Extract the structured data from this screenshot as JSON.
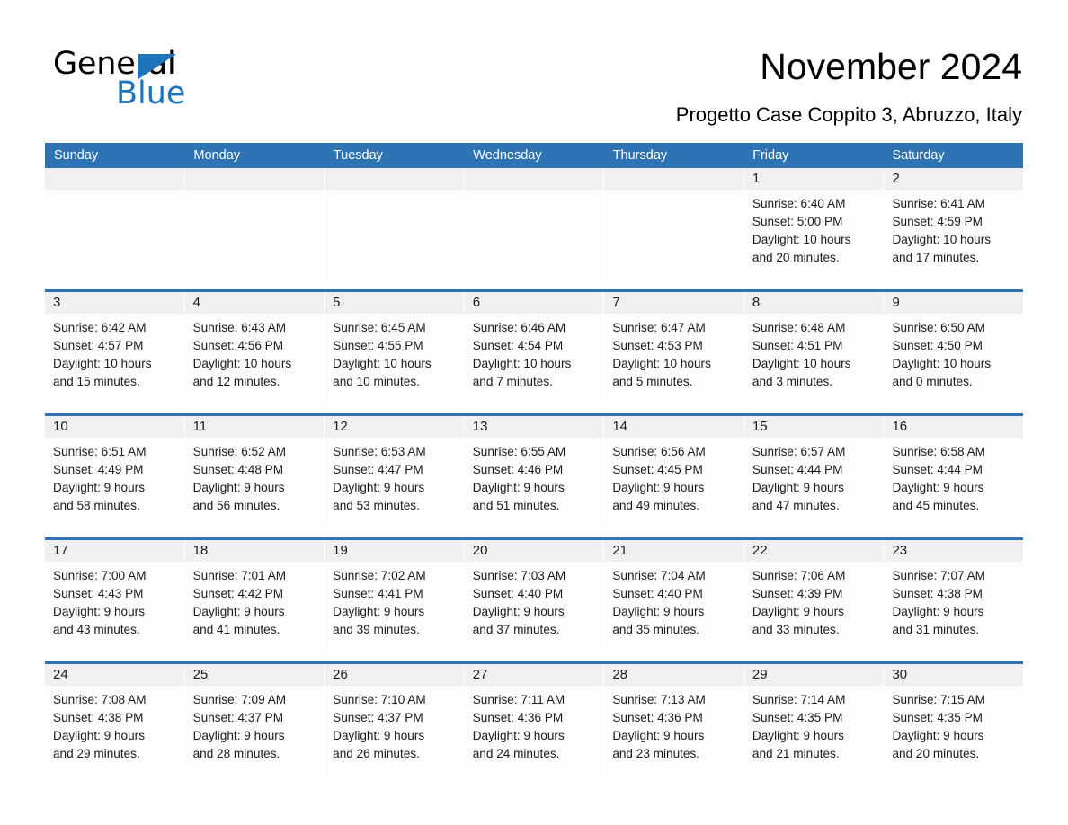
{
  "brand": {
    "name_part1": "General",
    "name_part2": "Blue",
    "accent_color": "#1f73b8"
  },
  "header": {
    "title": "November 2024",
    "subtitle": "Progetto Case Coppito 3, Abruzzo, Italy"
  },
  "theme": {
    "header_blue": "#2e74b5",
    "daynum_band": "#f0f0f0",
    "cell_bg": "#fdfdfd"
  },
  "weekdays": [
    "Sunday",
    "Monday",
    "Tuesday",
    "Wednesday",
    "Thursday",
    "Friday",
    "Saturday"
  ],
  "weeks": [
    [
      {
        "day": "",
        "lines": []
      },
      {
        "day": "",
        "lines": []
      },
      {
        "day": "",
        "lines": []
      },
      {
        "day": "",
        "lines": []
      },
      {
        "day": "",
        "lines": []
      },
      {
        "day": "1",
        "lines": [
          "Sunrise: 6:40 AM",
          "Sunset: 5:00 PM",
          "Daylight: 10 hours",
          "and 20 minutes."
        ]
      },
      {
        "day": "2",
        "lines": [
          "Sunrise: 6:41 AM",
          "Sunset: 4:59 PM",
          "Daylight: 10 hours",
          "and 17 minutes."
        ]
      }
    ],
    [
      {
        "day": "3",
        "lines": [
          "Sunrise: 6:42 AM",
          "Sunset: 4:57 PM",
          "Daylight: 10 hours",
          "and 15 minutes."
        ]
      },
      {
        "day": "4",
        "lines": [
          "Sunrise: 6:43 AM",
          "Sunset: 4:56 PM",
          "Daylight: 10 hours",
          "and 12 minutes."
        ]
      },
      {
        "day": "5",
        "lines": [
          "Sunrise: 6:45 AM",
          "Sunset: 4:55 PM",
          "Daylight: 10 hours",
          "and 10 minutes."
        ]
      },
      {
        "day": "6",
        "lines": [
          "Sunrise: 6:46 AM",
          "Sunset: 4:54 PM",
          "Daylight: 10 hours",
          "and 7 minutes."
        ]
      },
      {
        "day": "7",
        "lines": [
          "Sunrise: 6:47 AM",
          "Sunset: 4:53 PM",
          "Daylight: 10 hours",
          "and 5 minutes."
        ]
      },
      {
        "day": "8",
        "lines": [
          "Sunrise: 6:48 AM",
          "Sunset: 4:51 PM",
          "Daylight: 10 hours",
          "and 3 minutes."
        ]
      },
      {
        "day": "9",
        "lines": [
          "Sunrise: 6:50 AM",
          "Sunset: 4:50 PM",
          "Daylight: 10 hours",
          "and 0 minutes."
        ]
      }
    ],
    [
      {
        "day": "10",
        "lines": [
          "Sunrise: 6:51 AM",
          "Sunset: 4:49 PM",
          "Daylight: 9 hours",
          "and 58 minutes."
        ]
      },
      {
        "day": "11",
        "lines": [
          "Sunrise: 6:52 AM",
          "Sunset: 4:48 PM",
          "Daylight: 9 hours",
          "and 56 minutes."
        ]
      },
      {
        "day": "12",
        "lines": [
          "Sunrise: 6:53 AM",
          "Sunset: 4:47 PM",
          "Daylight: 9 hours",
          "and 53 minutes."
        ]
      },
      {
        "day": "13",
        "lines": [
          "Sunrise: 6:55 AM",
          "Sunset: 4:46 PM",
          "Daylight: 9 hours",
          "and 51 minutes."
        ]
      },
      {
        "day": "14",
        "lines": [
          "Sunrise: 6:56 AM",
          "Sunset: 4:45 PM",
          "Daylight: 9 hours",
          "and 49 minutes."
        ]
      },
      {
        "day": "15",
        "lines": [
          "Sunrise: 6:57 AM",
          "Sunset: 4:44 PM",
          "Daylight: 9 hours",
          "and 47 minutes."
        ]
      },
      {
        "day": "16",
        "lines": [
          "Sunrise: 6:58 AM",
          "Sunset: 4:44 PM",
          "Daylight: 9 hours",
          "and 45 minutes."
        ]
      }
    ],
    [
      {
        "day": "17",
        "lines": [
          "Sunrise: 7:00 AM",
          "Sunset: 4:43 PM",
          "Daylight: 9 hours",
          "and 43 minutes."
        ]
      },
      {
        "day": "18",
        "lines": [
          "Sunrise: 7:01 AM",
          "Sunset: 4:42 PM",
          "Daylight: 9 hours",
          "and 41 minutes."
        ]
      },
      {
        "day": "19",
        "lines": [
          "Sunrise: 7:02 AM",
          "Sunset: 4:41 PM",
          "Daylight: 9 hours",
          "and 39 minutes."
        ]
      },
      {
        "day": "20",
        "lines": [
          "Sunrise: 7:03 AM",
          "Sunset: 4:40 PM",
          "Daylight: 9 hours",
          "and 37 minutes."
        ]
      },
      {
        "day": "21",
        "lines": [
          "Sunrise: 7:04 AM",
          "Sunset: 4:40 PM",
          "Daylight: 9 hours",
          "and 35 minutes."
        ]
      },
      {
        "day": "22",
        "lines": [
          "Sunrise: 7:06 AM",
          "Sunset: 4:39 PM",
          "Daylight: 9 hours",
          "and 33 minutes."
        ]
      },
      {
        "day": "23",
        "lines": [
          "Sunrise: 7:07 AM",
          "Sunset: 4:38 PM",
          "Daylight: 9 hours",
          "and 31 minutes."
        ]
      }
    ],
    [
      {
        "day": "24",
        "lines": [
          "Sunrise: 7:08 AM",
          "Sunset: 4:38 PM",
          "Daylight: 9 hours",
          "and 29 minutes."
        ]
      },
      {
        "day": "25",
        "lines": [
          "Sunrise: 7:09 AM",
          "Sunset: 4:37 PM",
          "Daylight: 9 hours",
          "and 28 minutes."
        ]
      },
      {
        "day": "26",
        "lines": [
          "Sunrise: 7:10 AM",
          "Sunset: 4:37 PM",
          "Daylight: 9 hours",
          "and 26 minutes."
        ]
      },
      {
        "day": "27",
        "lines": [
          "Sunrise: 7:11 AM",
          "Sunset: 4:36 PM",
          "Daylight: 9 hours",
          "and 24 minutes."
        ]
      },
      {
        "day": "28",
        "lines": [
          "Sunrise: 7:13 AM",
          "Sunset: 4:36 PM",
          "Daylight: 9 hours",
          "and 23 minutes."
        ]
      },
      {
        "day": "29",
        "lines": [
          "Sunrise: 7:14 AM",
          "Sunset: 4:35 PM",
          "Daylight: 9 hours",
          "and 21 minutes."
        ]
      },
      {
        "day": "30",
        "lines": [
          "Sunrise: 7:15 AM",
          "Sunset: 4:35 PM",
          "Daylight: 9 hours",
          "and 20 minutes."
        ]
      }
    ]
  ]
}
